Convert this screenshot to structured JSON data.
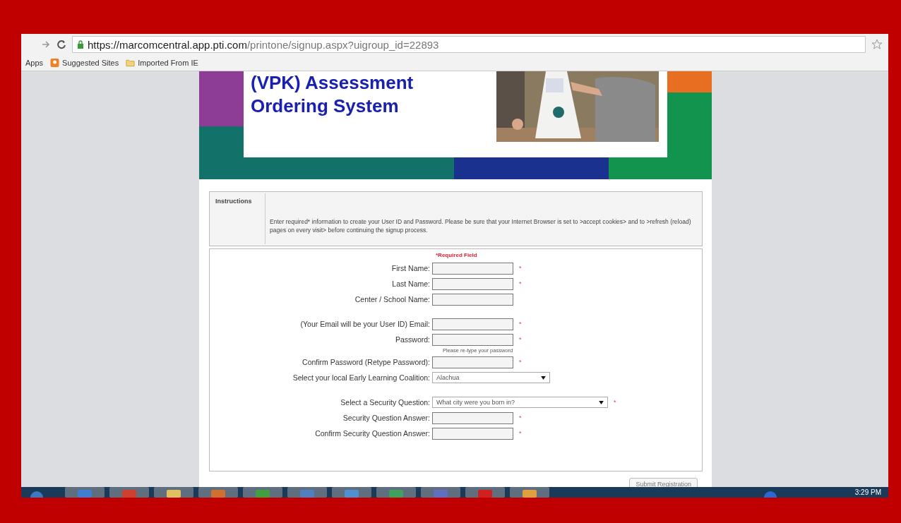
{
  "browser": {
    "url_host": "https://marcomcentral.app.pti.com",
    "url_path": "/printone/signup.aspx?uigroup_id=22893",
    "bookmarks": [
      {
        "label": "Apps",
        "kind": "apps"
      },
      {
        "label": "Suggested Sites",
        "kind": "site"
      },
      {
        "label": "Imported From IE",
        "kind": "folder"
      }
    ]
  },
  "banner": {
    "title_lines": [
      "(VPK) Assessment",
      "Ordering System"
    ],
    "kind": "picture"
  },
  "instructions": {
    "heading": "Instructions",
    "text": "Enter required* information to create your User ID and Password. Please be sure that your Internet Browser is set to >accept cookies> and to >refresh (reload) pages on every visit> before continuing the signup process."
  },
  "required_note": "*Required Field",
  "fields": [
    {
      "kind": "text",
      "label": "First Name:",
      "required": true,
      "gap_before": false
    },
    {
      "kind": "text",
      "label": "Last Name:",
      "required": true,
      "gap_before": false
    },
    {
      "kind": "text",
      "label": "Center / School Name:",
      "required": false,
      "gap_before": false
    },
    {
      "kind": "text",
      "label": "(Your Email will be your User ID) Email:",
      "required": true,
      "gap_before": true
    },
    {
      "kind": "text",
      "label": "Password:",
      "required": true,
      "gap_before": false
    },
    {
      "kind": "hint",
      "text": "Please re-type your password"
    },
    {
      "kind": "text",
      "label": "Confirm Password (Retype Password):",
      "required": true,
      "gap_before": false
    },
    {
      "kind": "select",
      "label": "Select your local Early Learning Coalition:",
      "value": "Alachua",
      "required": false,
      "gap_before": false
    },
    {
      "kind": "select",
      "label": "Select a Security Question:",
      "value": "What city were you born in?",
      "required": true,
      "gap_before": true
    },
    {
      "kind": "text",
      "label": "Security Question Answer:",
      "required": true,
      "gap_before": false
    },
    {
      "kind": "text",
      "label": "Confirm Security Question Answer:",
      "required": true,
      "gap_before": false
    }
  ],
  "required_mark": "*",
  "submit": "Submit Registration",
  "taskbar": {
    "clock": "3:29 PM"
  }
}
